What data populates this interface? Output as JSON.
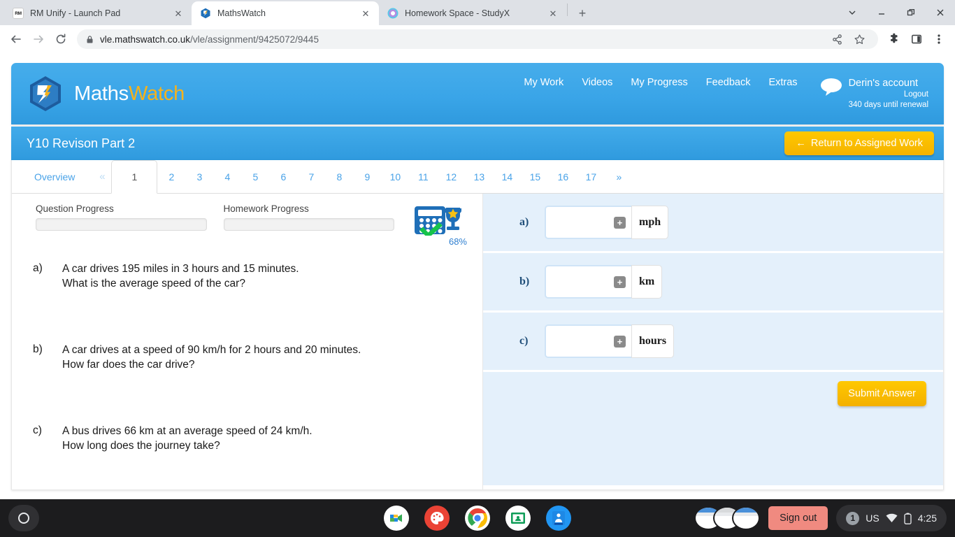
{
  "browser": {
    "tabs": [
      {
        "title": "RM Unify - Launch Pad",
        "favicon": "rm-unify-icon",
        "active": false,
        "close_label": "✕"
      },
      {
        "title": "MathsWatch",
        "favicon": "mathswatch-icon",
        "active": true,
        "close_label": "✕"
      },
      {
        "title": "Homework Space - StudyX",
        "favicon": "studyx-icon",
        "active": false,
        "close_label": "✕"
      }
    ],
    "new_tab_label": "+",
    "window_controls": [
      "chevron-down-icon",
      "minimize-icon",
      "restore-icon",
      "close-icon"
    ],
    "toolbar": {
      "back_label": "←",
      "forward_label": "→",
      "reload_label": "⟳",
      "lock_icon": "lock-icon",
      "url_host": "vle.mathswatch.co.uk",
      "url_path": "/vle/assignment/9425072/9445",
      "share_icon": "share-icon",
      "bookmark_icon": "star-icon",
      "extensions_icon": "puzzle-icon",
      "sidepanel_icon": "side-panel-icon",
      "menu_icon": "three-dot-menu-icon"
    }
  },
  "site": {
    "logo": {
      "text_primary": "Maths",
      "text_accent": "Watch"
    },
    "nav": [
      {
        "label": "My Work"
      },
      {
        "label": "Videos"
      },
      {
        "label": "My Progress"
      },
      {
        "label": "Feedback"
      },
      {
        "label": "Extras"
      }
    ],
    "account": {
      "name": "Derin's account",
      "logout": "Logout",
      "renewal": "340 days until renewal"
    },
    "assignment": {
      "title": "Y10 Revison Part 2",
      "return_button": "Return to Assigned Work",
      "return_arrow": "←"
    },
    "tabs": {
      "overview": "Overview",
      "prev": "«",
      "next": "»",
      "numbers": [
        "1",
        "2",
        "3",
        "4",
        "5",
        "6",
        "7",
        "8",
        "9",
        "10",
        "11",
        "12",
        "13",
        "14",
        "15",
        "16",
        "17"
      ],
      "active": "1"
    },
    "progress": {
      "question_label": "Question Progress",
      "question_value": 0,
      "homework_label": "Homework Progress",
      "homework_value": 0,
      "badge_percent": "68%",
      "badge_icon": "calculator-trophy-icon"
    },
    "question": {
      "parts": [
        {
          "label": "a)",
          "line1": "A car drives 195 miles in 3 hours and 15 minutes.",
          "line2": "What is the average speed of the car?"
        },
        {
          "label": "b)",
          "line1": "A car drives at a speed of 90 km/h for 2 hours and 20 minutes.",
          "line2": "How far does the car drive?"
        },
        {
          "label": "c)",
          "line1": "A bus drives 66 km at an average speed of 24 km/h.",
          "line2": "How long does the journey take?"
        }
      ]
    },
    "answers": {
      "rows": [
        {
          "label": "a)",
          "value": "",
          "unit": "mph",
          "plus": "+"
        },
        {
          "label": "b)",
          "value": "",
          "unit": "km",
          "plus": "+"
        },
        {
          "label": "c)",
          "value": "",
          "unit": "hours",
          "plus": "+"
        }
      ],
      "submit_label": "Submit Answer"
    },
    "colors": {
      "brand_blue": "#3aa5e8",
      "brand_yellow": "#f6b21b",
      "answer_panel": "#e4f0fb"
    }
  },
  "shelf": {
    "launcher_icon": "launcher-icon",
    "apps": [
      {
        "name": "google-meet-icon"
      },
      {
        "name": "paint-app-icon"
      },
      {
        "name": "chrome-icon"
      },
      {
        "name": "google-classroom-icon"
      },
      {
        "name": "blue-app-icon"
      }
    ],
    "sign_out": "Sign out",
    "tray": {
      "notification_count": "1",
      "keyboard_layout": "US",
      "wifi_icon": "wifi-icon",
      "battery_icon": "battery-icon",
      "time": "4:25"
    }
  }
}
